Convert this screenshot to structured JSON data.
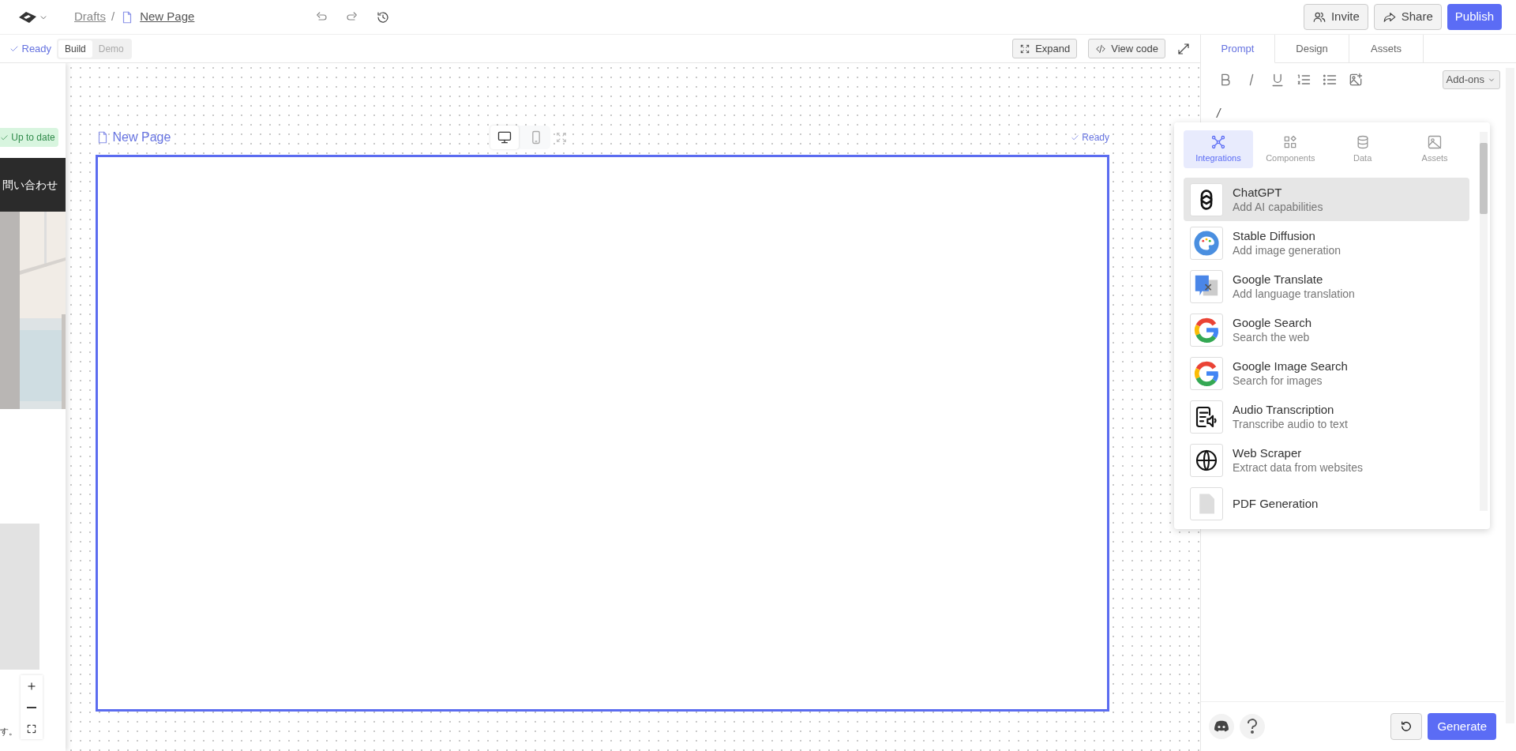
{
  "top_bar": {
    "breadcrumb": [
      "Drafts",
      "New Page"
    ],
    "separator": "/",
    "buttons": [
      {
        "label": "Invite",
        "kind": "invite"
      },
      {
        "label": "Share",
        "kind": "share"
      },
      {
        "label": "Publish",
        "kind": "publish"
      }
    ]
  },
  "sub_bar": {
    "status": "Ready",
    "modes": [
      {
        "label": "Build",
        "selected": true
      },
      {
        "label": "Demo",
        "selected": false
      }
    ],
    "buttons": [
      {
        "label": "Expand",
        "kind": "expand"
      },
      {
        "label": "View code",
        "kind": "code"
      }
    ]
  },
  "preview_page": {
    "badge": "Up to date",
    "header_text": "問い合わせ",
    "footer_text": "す。"
  },
  "canvas": {
    "page_title": "New Page",
    "devices": [
      {
        "kind": "desktop",
        "selected": true
      },
      {
        "kind": "mobile",
        "selected": false
      }
    ],
    "status": "Ready"
  },
  "panel": {
    "tabs": [
      {
        "label": "Prompt",
        "selected": true
      },
      {
        "label": "Design",
        "selected": false
      },
      {
        "label": "Assets",
        "selected": false
      }
    ],
    "addons": "Add-ons",
    "prompt_text": "/",
    "generate": "Generate"
  },
  "popup": {
    "tabs": [
      {
        "label": "Integrations",
        "kind": "integrations",
        "selected": true
      },
      {
        "label": "Components",
        "kind": "components",
        "selected": false
      },
      {
        "label": "Data",
        "kind": "data",
        "selected": false
      },
      {
        "label": "Assets",
        "kind": "assets",
        "selected": false
      }
    ],
    "items": [
      {
        "title": "ChatGPT",
        "subtitle": "Add AI capabilities",
        "selected": true
      },
      {
        "title": "Stable Diffusion",
        "subtitle": "Add image generation",
        "selected": false
      },
      {
        "title": "Google Translate",
        "subtitle": "Add language translation",
        "selected": false
      },
      {
        "title": "Google Search",
        "subtitle": "Search the web",
        "selected": false
      },
      {
        "title": "Google Image Search",
        "subtitle": "Search for images",
        "selected": false
      },
      {
        "title": "Audio Transcription",
        "subtitle": "Transcribe audio to text",
        "selected": false
      },
      {
        "title": "Web Scraper",
        "subtitle": "Extract data from websites",
        "selected": false
      },
      {
        "title": "PDF Generation",
        "selected": false
      }
    ]
  }
}
